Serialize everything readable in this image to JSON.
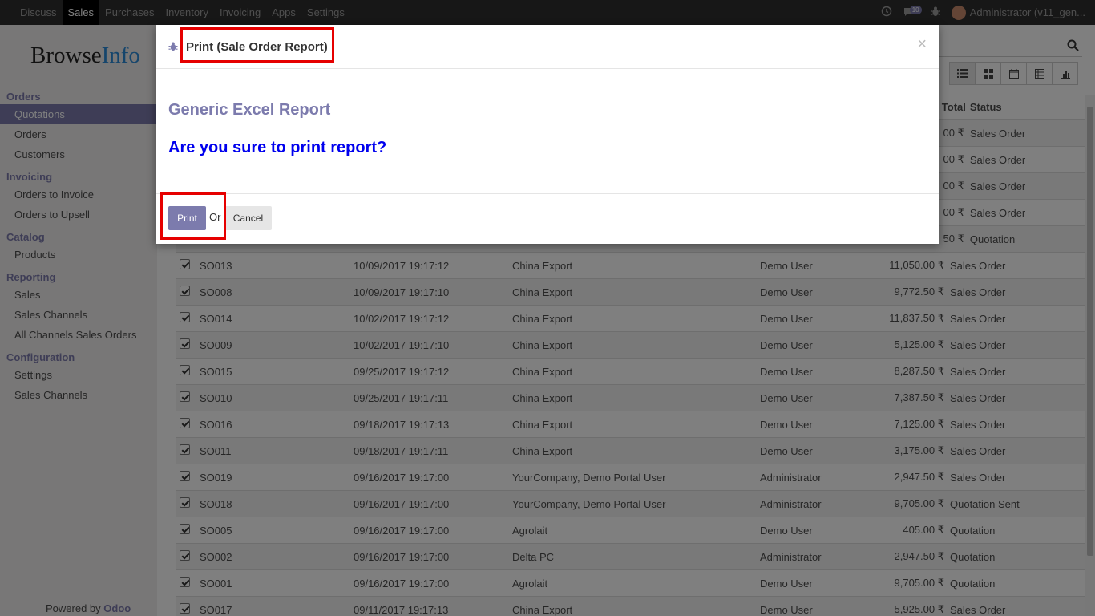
{
  "topbar": {
    "menu": [
      "Discuss",
      "Sales",
      "Purchases",
      "Inventory",
      "Invoicing",
      "Apps",
      "Settings"
    ],
    "active": "Sales",
    "messages_count": "10",
    "user": "Administrator (v11_gen..."
  },
  "sidebar": {
    "logo_a": "Browse",
    "logo_b": "Info",
    "sections": [
      {
        "title": "Orders",
        "items": [
          "Quotations",
          "Orders",
          "Customers"
        ]
      },
      {
        "title": "Invoicing",
        "items": [
          "Orders to Invoice",
          "Orders to Upsell"
        ]
      },
      {
        "title": "Catalog",
        "items": [
          "Products"
        ]
      },
      {
        "title": "Reporting",
        "items": [
          "Sales",
          "Sales Channels",
          "All Channels Sales Orders"
        ]
      },
      {
        "title": "Configuration",
        "items": [
          "Settings",
          "Sales Channels"
        ]
      }
    ],
    "active_item": "Quotations",
    "powered_by": "Powered by",
    "powered_brand": "Odoo"
  },
  "table": {
    "header_total": "Total",
    "header_status": "Status",
    "rows": [
      {
        "number": "SO013",
        "date": "10/09/2017 19:17:12",
        "customer": "China Export",
        "salesperson": "Demo User",
        "total": "11,050.00 ₹",
        "status": "Sales Order"
      },
      {
        "number": "SO008",
        "date": "10/09/2017 19:17:10",
        "customer": "China Export",
        "salesperson": "Demo User",
        "total": "9,772.50 ₹",
        "status": "Sales Order"
      },
      {
        "number": "SO014",
        "date": "10/02/2017 19:17:12",
        "customer": "China Export",
        "salesperson": "Demo User",
        "total": "11,837.50 ₹",
        "status": "Sales Order"
      },
      {
        "number": "SO009",
        "date": "10/02/2017 19:17:10",
        "customer": "China Export",
        "salesperson": "Demo User",
        "total": "5,125.00 ₹",
        "status": "Sales Order"
      },
      {
        "number": "SO015",
        "date": "09/25/2017 19:17:12",
        "customer": "China Export",
        "salesperson": "Demo User",
        "total": "8,287.50 ₹",
        "status": "Sales Order"
      },
      {
        "number": "SO010",
        "date": "09/25/2017 19:17:11",
        "customer": "China Export",
        "salesperson": "Demo User",
        "total": "7,387.50 ₹",
        "status": "Sales Order"
      },
      {
        "number": "SO016",
        "date": "09/18/2017 19:17:13",
        "customer": "China Export",
        "salesperson": "Demo User",
        "total": "7,125.00 ₹",
        "status": "Sales Order"
      },
      {
        "number": "SO011",
        "date": "09/18/2017 19:17:11",
        "customer": "China Export",
        "salesperson": "Demo User",
        "total": "3,175.00 ₹",
        "status": "Sales Order"
      },
      {
        "number": "SO019",
        "date": "09/16/2017 19:17:00",
        "customer": "YourCompany, Demo Portal User",
        "salesperson": "Administrator",
        "total": "2,947.50 ₹",
        "status": "Sales Order"
      },
      {
        "number": "SO018",
        "date": "09/16/2017 19:17:00",
        "customer": "YourCompany, Demo Portal User",
        "salesperson": "Administrator",
        "total": "9,705.00 ₹",
        "status": "Quotation Sent"
      },
      {
        "number": "SO005",
        "date": "09/16/2017 19:17:00",
        "customer": "Agrolait",
        "salesperson": "Demo User",
        "total": "405.00 ₹",
        "status": "Quotation"
      },
      {
        "number": "SO002",
        "date": "09/16/2017 19:17:00",
        "customer": "Delta PC",
        "salesperson": "Administrator",
        "total": "2,947.50 ₹",
        "status": "Quotation"
      },
      {
        "number": "SO001",
        "date": "09/16/2017 19:17:00",
        "customer": "Agrolait",
        "salesperson": "Demo User",
        "total": "9,705.00 ₹",
        "status": "Quotation"
      },
      {
        "number": "SO017",
        "date": "09/11/2017 19:17:13",
        "customer": "China Export",
        "salesperson": "Demo User",
        "total": "5,925.00 ₹",
        "status": "Sales Order"
      }
    ],
    "hidden_top_rows": [
      {
        "total": "00 ₹",
        "status": "Sales Order"
      },
      {
        "total": "00 ₹",
        "status": "Sales Order"
      },
      {
        "total": "00 ₹",
        "status": "Sales Order"
      },
      {
        "total": "00 ₹",
        "status": "Sales Order"
      },
      {
        "total": "50 ₹",
        "status": "Quotation"
      }
    ]
  },
  "modal": {
    "title": "Print (Sale Order Report)",
    "close": "×",
    "report_name": "Generic Excel Report",
    "question": "Are you sure to print report?",
    "print_label": "Print",
    "or_label": "Or",
    "cancel_label": "Cancel"
  }
}
